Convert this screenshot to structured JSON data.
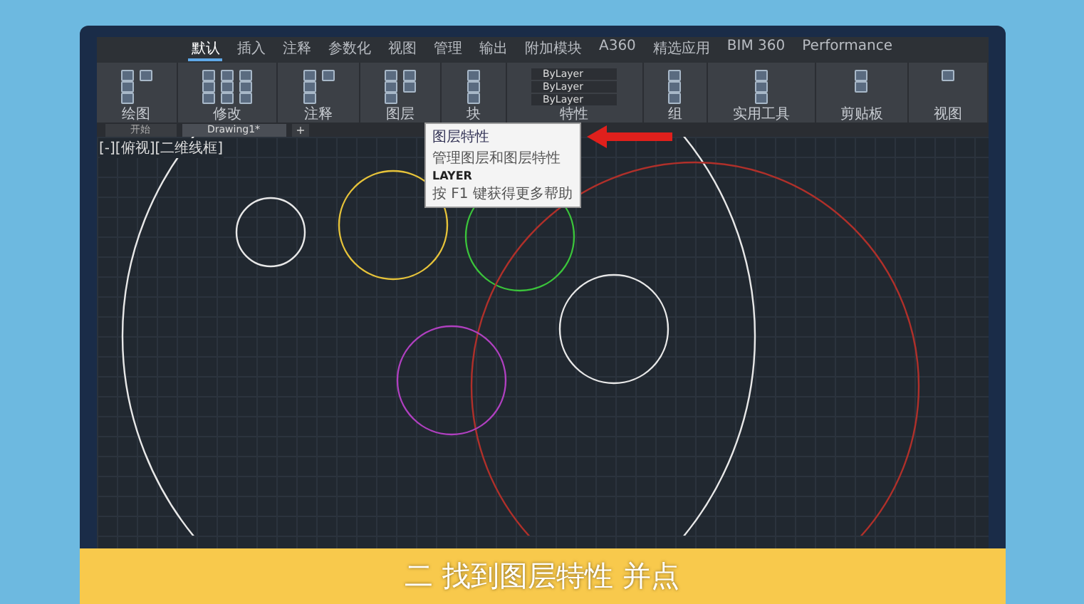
{
  "ribbon_tabs": [
    {
      "label": "默认",
      "selected": true
    },
    {
      "label": "插入",
      "selected": false
    },
    {
      "label": "注释",
      "selected": false
    },
    {
      "label": "参数化",
      "selected": false
    },
    {
      "label": "视图",
      "selected": false
    },
    {
      "label": "管理",
      "selected": false
    },
    {
      "label": "输出",
      "selected": false
    },
    {
      "label": "附加模块",
      "selected": false
    },
    {
      "label": "A360",
      "selected": false
    },
    {
      "label": "精选应用",
      "selected": false
    },
    {
      "label": "BIM 360",
      "selected": false
    },
    {
      "label": "Performance",
      "selected": false
    }
  ],
  "panels": [
    {
      "label": "绘图"
    },
    {
      "label": "修改"
    },
    {
      "label": "注释"
    },
    {
      "label": "图层"
    },
    {
      "label": "块"
    },
    {
      "label": "特性",
      "properties": [
        "ByLayer",
        "ByLayer",
        "ByLayer"
      ]
    },
    {
      "label": "组"
    },
    {
      "label": "实用工具"
    },
    {
      "label": "剪贴板"
    },
    {
      "label": "视图"
    }
  ],
  "tooltip": {
    "title": "图层特性",
    "description": "管理图层和图层特性",
    "command": "LAYER",
    "help": "按 F1 键获得更多帮助"
  },
  "document_tabs": [
    {
      "label": "开始",
      "selected": false
    },
    {
      "label": "Drawing1*",
      "selected": true
    }
  ],
  "new_tab_button": "+",
  "viewport_label": "[-][俯视][二维线框]",
  "circles": [
    {
      "color": "#e8e8e8"
    },
    {
      "color": "#e8e8e8"
    },
    {
      "color": "#e6c33a"
    },
    {
      "color": "#3bc43b"
    },
    {
      "color": "#b0302a"
    },
    {
      "color": "#e8e8e8"
    },
    {
      "color": "#b040c0"
    }
  ],
  "caption": "二 找到图层特性 并点"
}
